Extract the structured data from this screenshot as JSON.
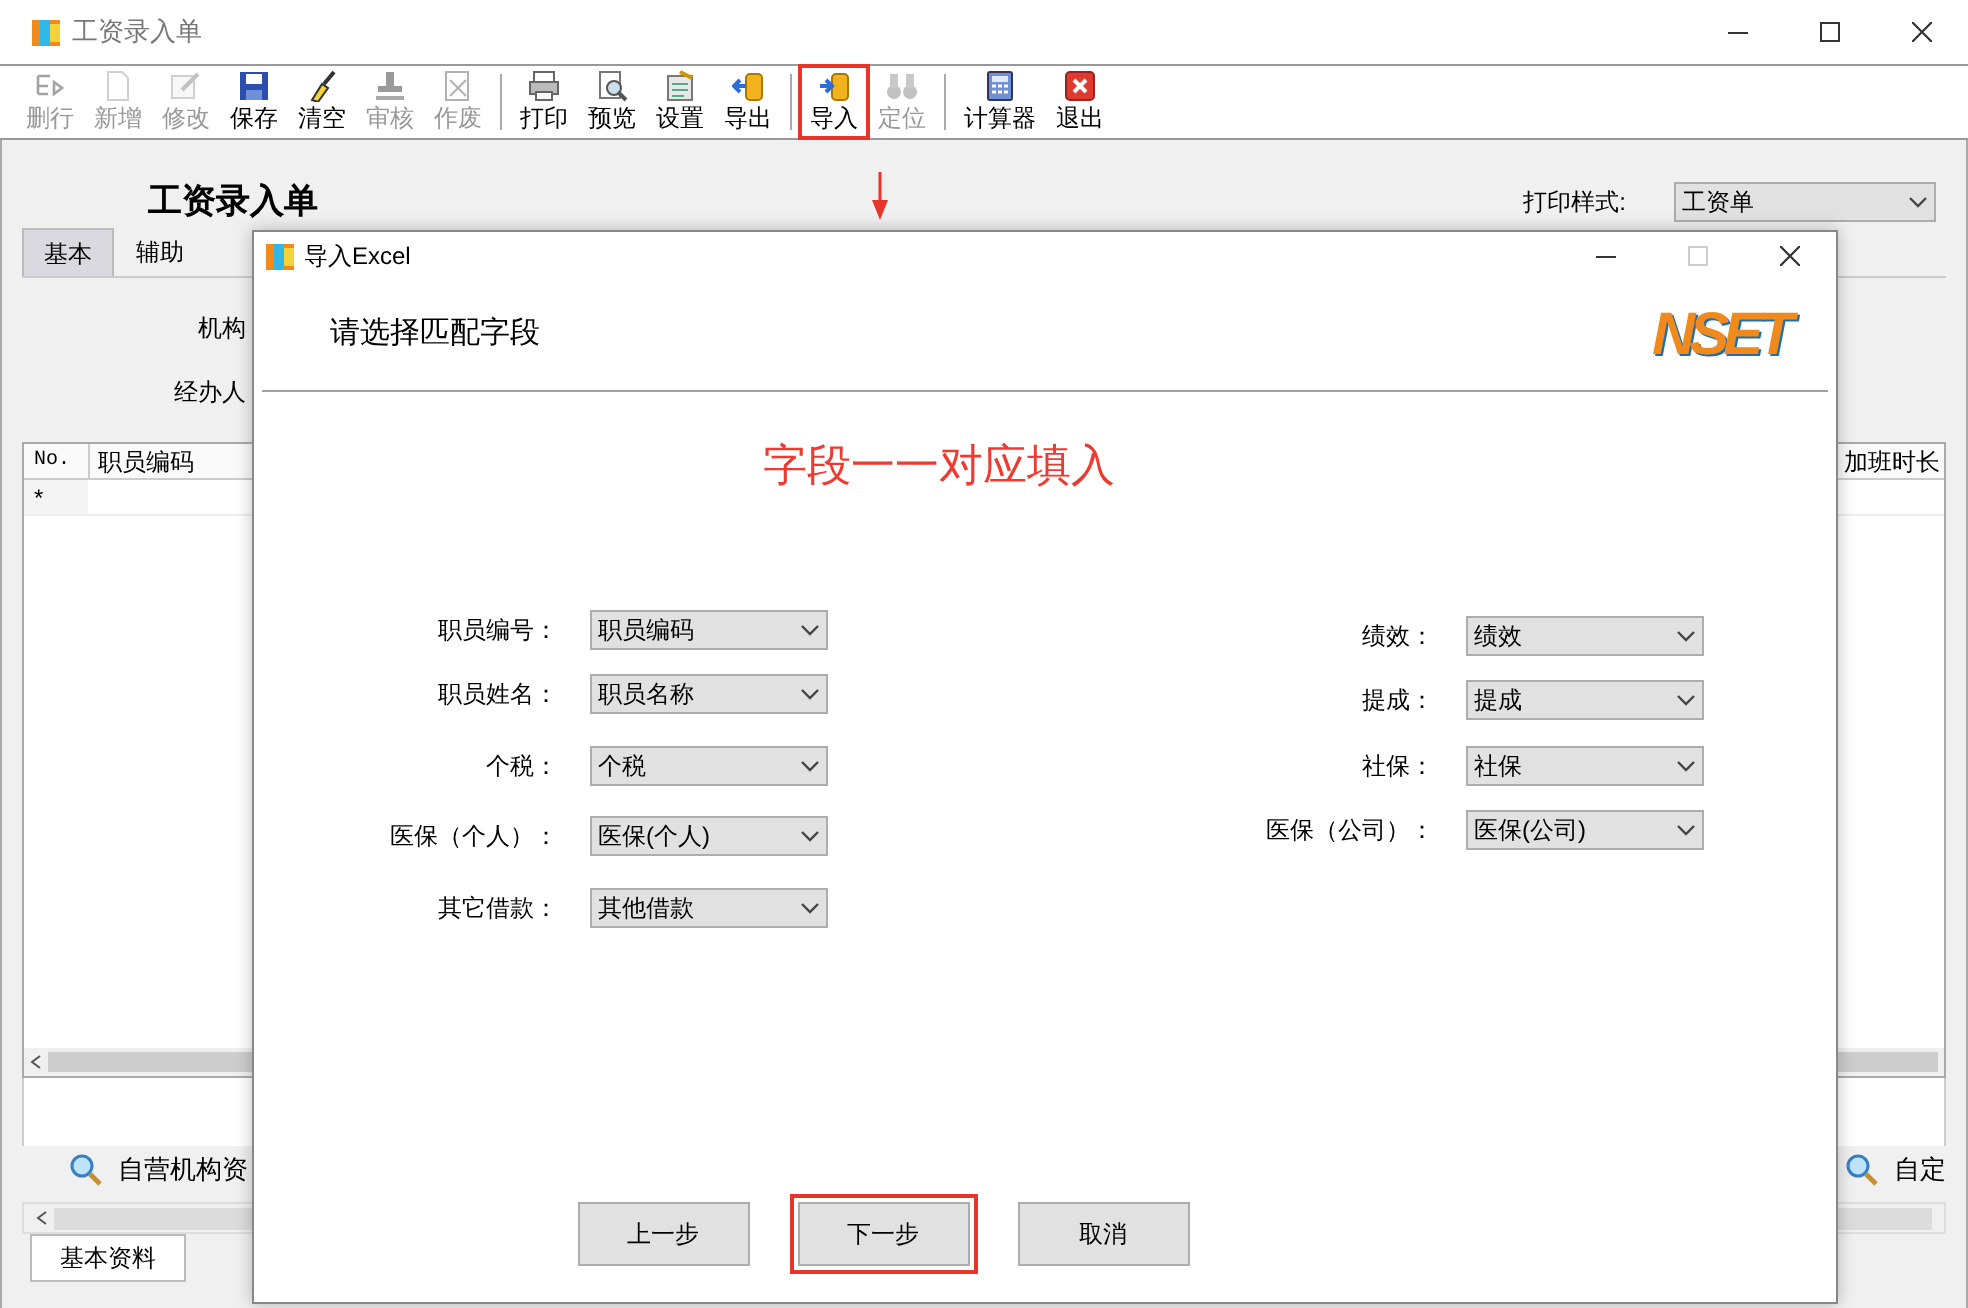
{
  "window": {
    "title": "工资录入单"
  },
  "toolbar": {
    "groups": [
      [
        {
          "label": "删行",
          "disabled": true,
          "highlighted": false
        },
        {
          "label": "新增",
          "disabled": true,
          "highlighted": false
        },
        {
          "label": "修改",
          "disabled": true,
          "highlighted": false
        },
        {
          "label": "保存",
          "disabled": false,
          "highlighted": false
        },
        {
          "label": "清空",
          "disabled": false,
          "highlighted": false
        },
        {
          "label": "审核",
          "disabled": true,
          "highlighted": false
        },
        {
          "label": "作废",
          "disabled": true,
          "highlighted": false
        }
      ],
      [
        {
          "label": "打印",
          "disabled": false,
          "highlighted": false
        },
        {
          "label": "预览",
          "disabled": false,
          "highlighted": false
        },
        {
          "label": "设置",
          "disabled": false,
          "highlighted": false
        },
        {
          "label": "导出",
          "disabled": false,
          "highlighted": false
        }
      ],
      [
        {
          "label": "导入",
          "disabled": false,
          "highlighted": true
        },
        {
          "label": "定位",
          "disabled": true,
          "highlighted": false
        }
      ],
      [
        {
          "label": "计算器",
          "disabled": false,
          "highlighted": false
        },
        {
          "label": "退出",
          "disabled": false,
          "highlighted": false
        }
      ]
    ]
  },
  "form": {
    "title": "工资录入单",
    "print_style": {
      "label": "打印样式:",
      "value": "工资单"
    },
    "tabs": [
      {
        "label": "基本",
        "selected": true
      },
      {
        "label": "辅助",
        "selected": false
      }
    ],
    "fields": [
      {
        "label": "机构"
      },
      {
        "label": "经办人"
      }
    ]
  },
  "grid": {
    "columns": [
      "No.",
      "职员编码",
      "加班时长"
    ],
    "new_row_marker": "*"
  },
  "lookups": [
    {
      "label": "自营机构资"
    },
    {
      "label": "自定"
    }
  ],
  "bottom_tabs": [
    {
      "label": "基本资料",
      "selected": true
    }
  ],
  "dialog": {
    "title": "导入Excel",
    "heading": "请选择匹配字段",
    "logo": "NSET",
    "instruction": "字段一一对应填入",
    "left_fields": [
      {
        "label": "职员编号：",
        "value": "职员编码"
      },
      {
        "label": "职员姓名：",
        "value": "职员名称"
      },
      {
        "label": "个税：",
        "value": "个税"
      },
      {
        "label": "医保（个人）：",
        "value": "医保(个人)"
      },
      {
        "label": "其它借款：",
        "value": "其他借款"
      }
    ],
    "right_fields": [
      {
        "label": "绩效：",
        "value": "绩效"
      },
      {
        "label": "提成：",
        "value": "提成"
      },
      {
        "label": "社保：",
        "value": "社保"
      },
      {
        "label": "医保（公司）：",
        "value": "医保(公司)"
      }
    ],
    "buttons": [
      {
        "label": "上一步",
        "highlighted": false
      },
      {
        "label": "下一步",
        "highlighted": true
      },
      {
        "label": "取消",
        "highlighted": false
      }
    ]
  }
}
